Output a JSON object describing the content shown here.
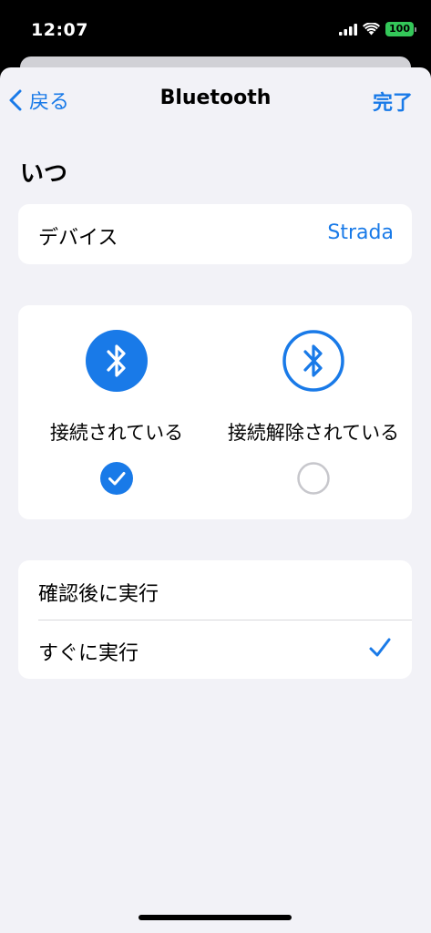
{
  "status_bar": {
    "time": "12:07",
    "battery": "100",
    "icons": [
      "signal-icon",
      "wifi-icon",
      "battery-icon"
    ]
  },
  "nav": {
    "back_label": "戻る",
    "title": "Bluetooth",
    "done_label": "完了"
  },
  "when": {
    "header": "いつ",
    "device_label": "デバイス",
    "device_value": "Strada"
  },
  "state_options": [
    {
      "label": "接続されている",
      "selected": true,
      "icon": "bluetooth-filled-icon"
    },
    {
      "label": "接続解除されている",
      "selected": false,
      "icon": "bluetooth-outline-icon"
    }
  ],
  "run_options": [
    {
      "label": "確認後に実行",
      "selected": false
    },
    {
      "label": "すぐに実行",
      "selected": true
    }
  ],
  "colors": {
    "accent": "#197ae8",
    "background": "#f2f2f7",
    "card": "#ffffff",
    "battery": "#34c759"
  }
}
